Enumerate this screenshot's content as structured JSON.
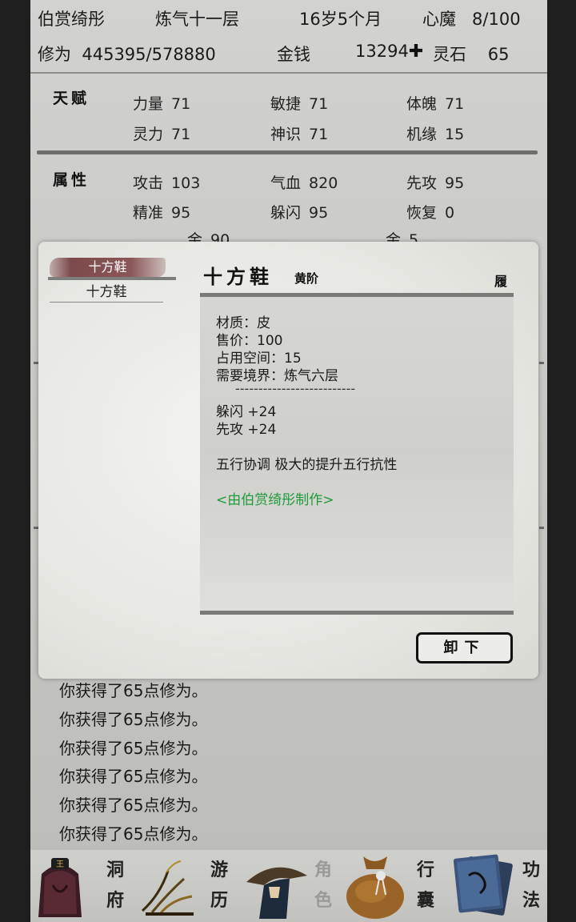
{
  "header": {
    "name": "伯赏绮彤",
    "realm": "炼气十一层",
    "age": "16岁5个月",
    "demon_label": "心魔",
    "demon_value": "8/100",
    "cultivation_label": "修为",
    "cultivation_value": "445395/578880",
    "money_label": "金钱",
    "money_value": "13294",
    "stone_label": "灵石",
    "stone_value": "65"
  },
  "talent": {
    "title": "天赋",
    "stats": [
      {
        "label": "力量",
        "value": "71"
      },
      {
        "label": "敏捷",
        "value": "71"
      },
      {
        "label": "体魄",
        "value": "71"
      },
      {
        "label": "灵力",
        "value": "71"
      },
      {
        "label": "神识",
        "value": "71"
      },
      {
        "label": "机缘",
        "value": "15"
      }
    ]
  },
  "attributes": {
    "title": "属性",
    "stats": [
      {
        "label": "攻击",
        "value": "103"
      },
      {
        "label": "气血",
        "value": "820"
      },
      {
        "label": "先攻",
        "value": "95"
      },
      {
        "label": "精准",
        "value": "95"
      },
      {
        "label": "躲闪",
        "value": "95"
      },
      {
        "label": "恢复",
        "value": "0"
      }
    ],
    "partial_row": [
      {
        "label": "金",
        "value": "90"
      },
      {
        "label": "金",
        "value": "5"
      }
    ]
  },
  "modal": {
    "tab_label": "十方鞋",
    "list_items": [
      "十方鞋"
    ],
    "item_name": "十方鞋",
    "item_grade": "黄阶",
    "item_slot": "履",
    "details": {
      "material": "材质：皮",
      "price": "售价：100",
      "space": "占用空间：15",
      "required_realm": "需要境界：炼气六层",
      "separator": "--------------------------",
      "bonus_1": "躲闪 +24",
      "bonus_2": "先攻 +24",
      "description": "五行协调 极大的提升五行抗性",
      "maker": "<由伯赏绮彤制作>"
    },
    "unequip_label": "卸下"
  },
  "log": [
    "你获得了65点修为。",
    "你获得了65点修为。",
    "你获得了65点修为。",
    "你获得了65点修为。",
    "你获得了65点修为。",
    "你获得了65点修为。"
  ],
  "nav": {
    "cave": [
      "洞",
      "府"
    ],
    "travel": [
      "游",
      "历"
    ],
    "character": [
      "角",
      "色"
    ],
    "bag": [
      "行",
      "囊"
    ],
    "skills": [
      "功",
      "法"
    ]
  },
  "colors": {
    "maker_text": "#1e9b3a",
    "tab_brush": "#7d4a4c",
    "background": "#c9c9c6"
  }
}
